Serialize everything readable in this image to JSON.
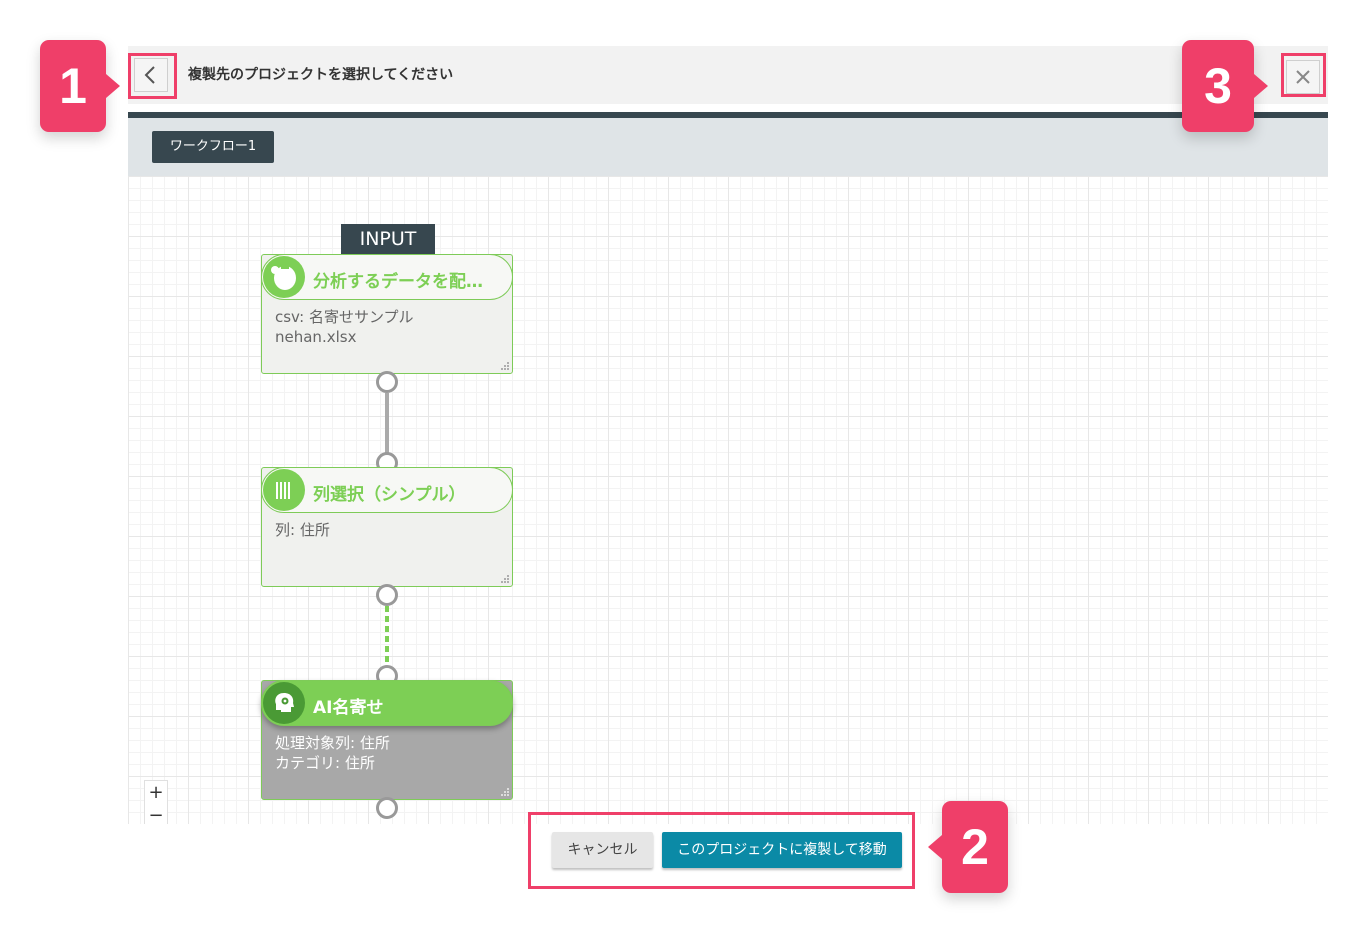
{
  "dialog": {
    "title": "複製先のプロジェクトを選択してください",
    "back_icon": "chevron-left-icon",
    "close_icon": "close-icon"
  },
  "tabs": [
    {
      "label": "ワークフロー1"
    }
  ],
  "workflow": {
    "input_label": "INPUT",
    "nodes": [
      {
        "title": "分析するデータを配…",
        "icon": "database-icon",
        "lines": [
          "csv: 名寄せサンプル",
          "nehan.xlsx"
        ]
      },
      {
        "title": "列選択（シンプル）",
        "icon": "columns-icon",
        "lines": [
          "列: 住所"
        ]
      },
      {
        "title": "AI名寄せ",
        "icon": "ai-head-icon",
        "lines": [
          "処理対象列: 住所",
          "カテゴリ: 住所"
        ],
        "selected": true
      }
    ]
  },
  "zoom": {
    "plus": "+",
    "minus": "−"
  },
  "footer": {
    "cancel_label": "キャンセル",
    "copy_label": "このプロジェクトに複製して移動"
  },
  "annotations": [
    {
      "label": "1"
    },
    {
      "label": "2"
    },
    {
      "label": "3"
    }
  ],
  "colors": {
    "accent_pink": "#ef3f69",
    "node_green": "#7dcf55",
    "primary_button": "#0b8aa6",
    "dark_bar": "#37474f"
  }
}
